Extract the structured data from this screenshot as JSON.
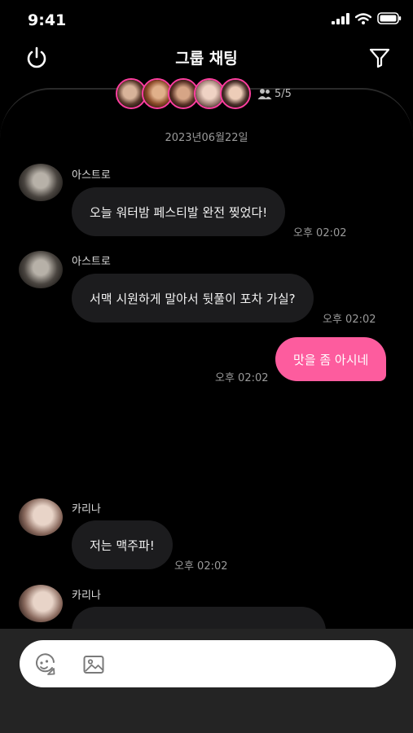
{
  "status_bar": {
    "time": "9:41"
  },
  "header": {
    "title": "그룹 채팅"
  },
  "members": {
    "count": "5/5",
    "accent": "#ff3fa0"
  },
  "date_separator": "2023년06월22일",
  "messages": [
    {
      "sender": "아스트로",
      "text": "오늘 워터밤 페스티발 완전 찢었다!",
      "time": "오후 02:02"
    },
    {
      "sender": "아스트로",
      "text": "서맥 시원하게 말아서 뒷풀이 포차 가실?",
      "time": "오후 02:02"
    },
    {
      "text": "맛을 좀 아시네",
      "time": "오후 02:02"
    },
    {
      "sender": "카리나",
      "text": "저는 맥주파!",
      "time": "오후 02:02"
    },
    {
      "sender": "카리나",
      "text": "",
      "time": ""
    }
  ],
  "colors": {
    "sent_bubble": "#fd5c9e",
    "received_bubble": "#1c1c1e",
    "background": "#000000",
    "input_bar": "#242424"
  },
  "icons": [
    "power-icon",
    "filter-icon",
    "people-icon",
    "emoji-icon",
    "image-icon"
  ]
}
